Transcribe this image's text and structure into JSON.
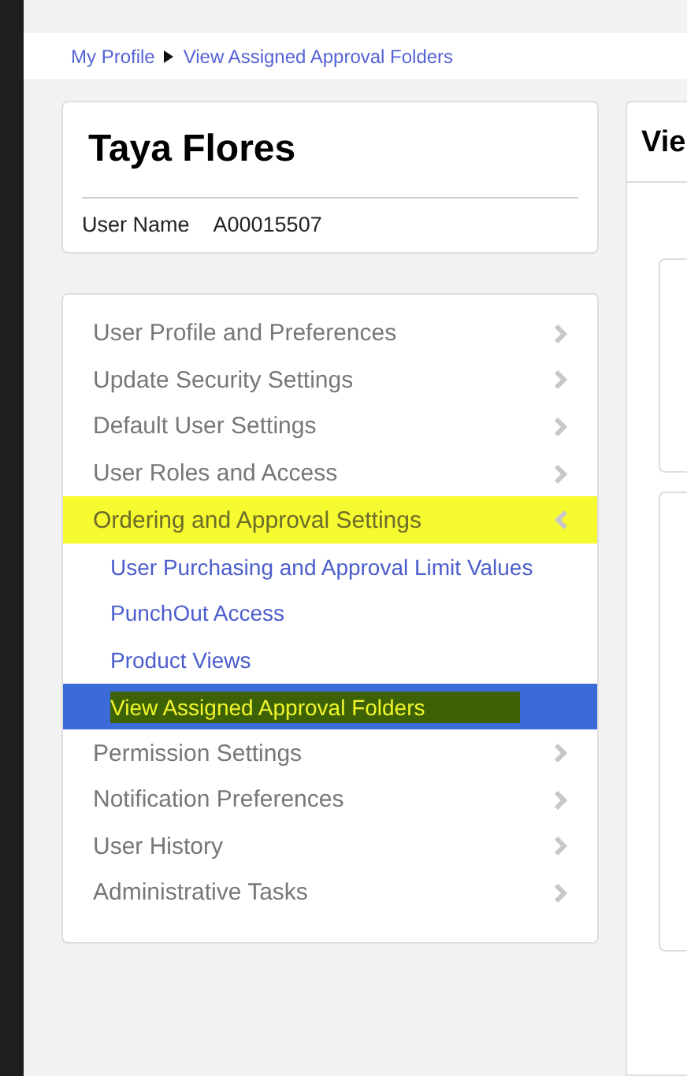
{
  "breadcrumb": [
    {
      "label": "My Profile"
    },
    {
      "label": "View Assigned Approval Folders"
    }
  ],
  "profile": {
    "name": "Taya Flores",
    "field_label": "User Name",
    "field_value": "A00015507"
  },
  "nav": [
    {
      "kind": "section",
      "label": "User Profile and Preferences",
      "expanded": false,
      "highlighted": false
    },
    {
      "kind": "section",
      "label": "Update Security Settings",
      "expanded": false,
      "highlighted": false
    },
    {
      "kind": "section",
      "label": "Default User Settings",
      "expanded": false,
      "highlighted": false
    },
    {
      "kind": "section",
      "label": "User Roles and Access",
      "expanded": false,
      "highlighted": false
    },
    {
      "kind": "section",
      "label": "Ordering and Approval Settings",
      "expanded": true,
      "highlighted": true
    },
    {
      "kind": "sub",
      "label": "User Purchasing and Approval Limit Values",
      "selected": false,
      "highlighted": false
    },
    {
      "kind": "sub",
      "label": "PunchOut Access",
      "selected": false,
      "highlighted": false
    },
    {
      "kind": "sub",
      "label": "Product Views",
      "selected": false,
      "highlighted": false
    },
    {
      "kind": "sub",
      "label": "View Assigned Approval Folders",
      "selected": true,
      "highlighted": true
    },
    {
      "kind": "section",
      "label": "Permission Settings",
      "expanded": false,
      "highlighted": false
    },
    {
      "kind": "section",
      "label": "Notification Preferences",
      "expanded": false,
      "highlighted": false
    },
    {
      "kind": "section",
      "label": "User History",
      "expanded": false,
      "highlighted": false
    },
    {
      "kind": "section",
      "label": "Administrative Tasks",
      "expanded": false,
      "highlighted": false
    }
  ],
  "main_panel": {
    "title": "Vie"
  }
}
